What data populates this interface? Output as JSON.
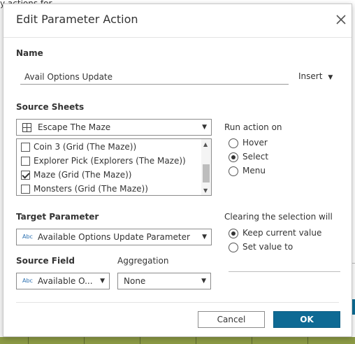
{
  "dialog": {
    "title": "Edit Parameter Action",
    "name_label": "Name",
    "name_value": "Avail Options Update",
    "insert_label": "Insert",
    "source_sheets_label": "Source Sheets",
    "source_sheet_selected": "Escape The Maze",
    "sheets": [
      {
        "label": "Coin 3 (Grid (The Maze))",
        "checked": false
      },
      {
        "label": "Explorer Pick (Explorers (The Maze))",
        "checked": false
      },
      {
        "label": "Maze (Grid (The Maze))",
        "checked": true
      },
      {
        "label": "Monsters (Grid (The Maze))",
        "checked": false
      }
    ],
    "run_action_label": "Run action on",
    "run_options": [
      {
        "label": "Hover",
        "selected": false
      },
      {
        "label": "Select",
        "selected": true
      },
      {
        "label": "Menu",
        "selected": false
      }
    ],
    "target_parameter_label": "Target Parameter",
    "target_parameter_value": "Available Options Update Parameter",
    "type_badge": "Abc",
    "clearing_label": "Clearing the selection will",
    "clearing_options": [
      {
        "label": "Keep current value",
        "selected": true
      },
      {
        "label": "Set value to",
        "selected": false
      }
    ],
    "source_field_label": "Source Field",
    "source_field_value": "Available O...",
    "aggregation_label": "Aggregation",
    "aggregation_value": "None",
    "cancel_label": "Cancel",
    "ok_label": "OK"
  },
  "background": {
    "title_fragment": "y actions for"
  },
  "colors": {
    "ok_button": "#0e6a94",
    "type_badge": "#2a6fb0",
    "background_grid": "#8c9a45"
  },
  "icons": {
    "close": "close-icon",
    "sheet": "worksheet-grid-icon",
    "dropdown": "caret-down-icon"
  }
}
